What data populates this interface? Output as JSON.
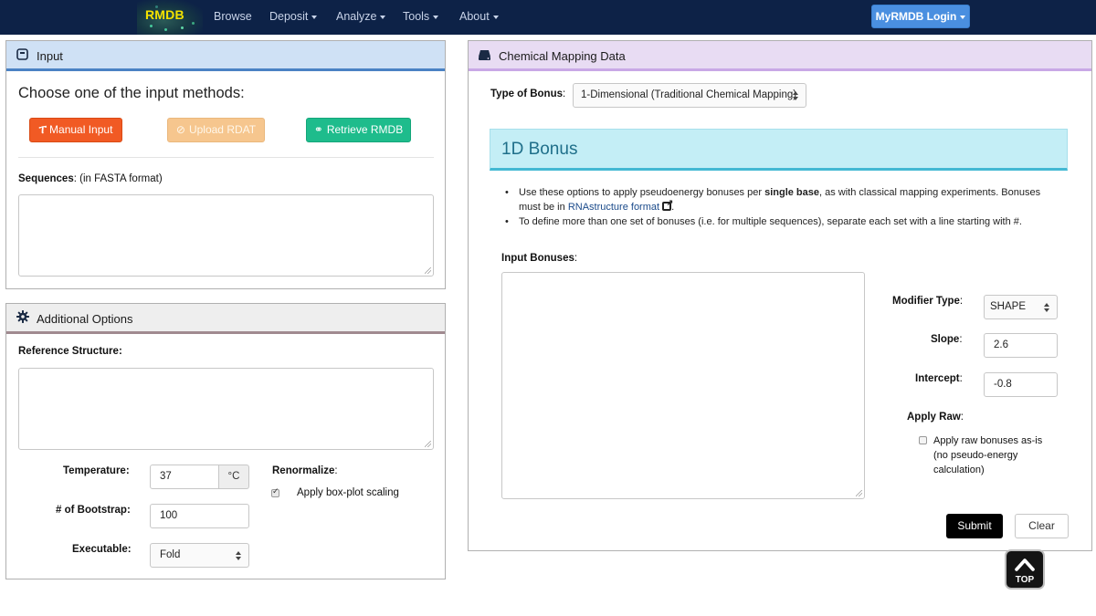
{
  "navbar": {
    "brand": "RMDB",
    "items": [
      "Browse",
      "Deposit",
      "Analyze",
      "Tools",
      "About"
    ],
    "login_label": "MyRMDB Login"
  },
  "input_panel": {
    "title": "Input",
    "choose_text": "Choose one of the input methods:",
    "buttons": {
      "manual": "Manual Input",
      "upload": "Upload RDAT",
      "retrieve": "Retrieve RMDB"
    },
    "sequences_label": "Sequences",
    "sequences_hint": ": (in FASTA format)",
    "sequences_value": ""
  },
  "options_panel": {
    "title": "Additional Options",
    "reference_label": "Reference Structure",
    "reference_value": "",
    "temperature_label": "Temperature",
    "temperature_value": "37",
    "temperature_unit": "°C",
    "bootstrap_label": "# of Bootstrap",
    "bootstrap_value": "100",
    "executable_label": "Executable",
    "executable_value": "Fold",
    "renormalize_label": "Renormalize",
    "renormalize_option": "Apply box-plot scaling",
    "renormalize_checked": true
  },
  "chem_panel": {
    "title": "Chemical Mapping Data",
    "type_label": "Type of Bonus",
    "type_value": "1-Dimensional (Traditional Chemical Mapping)",
    "banner_title": "1D Bonus",
    "bullet1_a": "Use these options to apply pseudoenergy bonuses per ",
    "bullet1_b": "single base",
    "bullet1_c": ", as with classical mapping experiments. Bonuses",
    "bullet1_d": "must be in ",
    "bullet1_link": "RNAstructure format",
    "bullet1_e": ".",
    "bullet2": "To define more than one set of bonuses (i.e. for multiple sequences), separate each set with a line starting with #.",
    "input_bonuses_label": "Input Bonuses",
    "input_bonuses_value": "",
    "modifier_label": "Modifier Type",
    "modifier_value": "SHAPE",
    "slope_label": "Slope",
    "slope_value": "2.6",
    "intercept_label": "Intercept",
    "intercept_value": "-0.8",
    "apply_raw_label": "Apply Raw",
    "apply_raw_option_1": "Apply raw bonuses as-is",
    "apply_raw_option_2": "(no pseudo-energy",
    "apply_raw_option_3": "calculation)",
    "apply_raw_checked": false,
    "submit_label": "Submit",
    "clear_label": "Clear"
  },
  "top_button": "TOP"
}
